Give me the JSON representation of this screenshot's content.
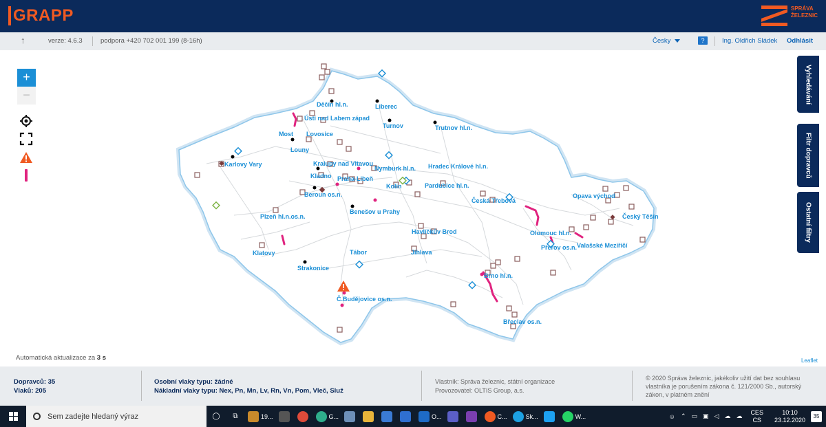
{
  "header": {
    "logo_text": "GRAPP",
    "brand_line1": "SPRÁVA",
    "brand_line2": "ŽELEZNIC"
  },
  "subbar": {
    "version": "verze: 4.6.3",
    "support": "podpora +420 702 001 199 (8-16h)",
    "language": "Česky",
    "help_label": "?",
    "user": "Ing. Oldřich Sládek",
    "logout": "Odhlásit"
  },
  "map": {
    "zoom_in": "+",
    "zoom_out": "−",
    "cities": [
      "Děčín hl.n.",
      "Liberec",
      "Ústí nad Labem západ",
      "Turnov",
      "Trutnov hl.n.",
      "Most",
      "Lovosice",
      "Louny",
      "Karlovy Vary",
      "Kralupy nad Vltavou",
      "Nymburk hl.n.",
      "Hradec Králové hl.n.",
      "Kladno",
      "Praha-Libeň",
      "Kolín",
      "Pardubice hl.n.",
      "Beroun os.n.",
      "Česká Třebová",
      "Opava východ",
      "Benešov u Prahy",
      "Plzeň hl.n.os.n.",
      "Český Těšín",
      "Havlíčkův Brod",
      "Olomouc hl.n.",
      "Přerov os.n.",
      "Valašské Meziříčí",
      "Klatovy",
      "Jihlava",
      "Tábor",
      "Strakonice",
      "Brno hl.n.",
      "Č.Budějovice os.n.",
      "Břeclav os.n."
    ],
    "auto_update_prefix": "Automatická aktualizace za",
    "auto_update_value": "3 s",
    "attribution": "Leaflet"
  },
  "side_buttons": {
    "search": "Vyhledávání",
    "carrier_filter": "Filtr dopravců",
    "other_filters": "Ostatní filtry"
  },
  "footer": {
    "carriers": "Dopravců: 35",
    "trains": "Vlaků: 205",
    "passenger_types": "Osobní vlaky typu: žádné",
    "freight_types": "Nákladní vlaky typu: Nex, Pn, Mn, Lv, Rn, Vn, Pom, Vleč, Služ",
    "owner": "Vlastník: Správa železnic, státní organizace",
    "operator": "Provozovatel: OLTIS Group, a.s.",
    "copyright": "© 2020 Správa železnic, jakékoliv užití dat bez souhlasu vlastníka je porušením zákona č. 121/2000 Sb., autorský zákon, v platném znění"
  },
  "taskbar": {
    "search_placeholder": "Sem zadejte hledaný výraz",
    "apps": [
      "19...",
      "G...",
      "O...",
      "C...",
      "Sk...",
      "W..."
    ],
    "lang1": "CES",
    "lang2": "CS",
    "time": "10:10",
    "date": "23.12.2020",
    "notifications": "35"
  },
  "colors": {
    "navy": "#0b2a5b",
    "accent_orange": "#f05a22",
    "link_blue": "#1b8fd6",
    "magenta": "#e0237f"
  }
}
